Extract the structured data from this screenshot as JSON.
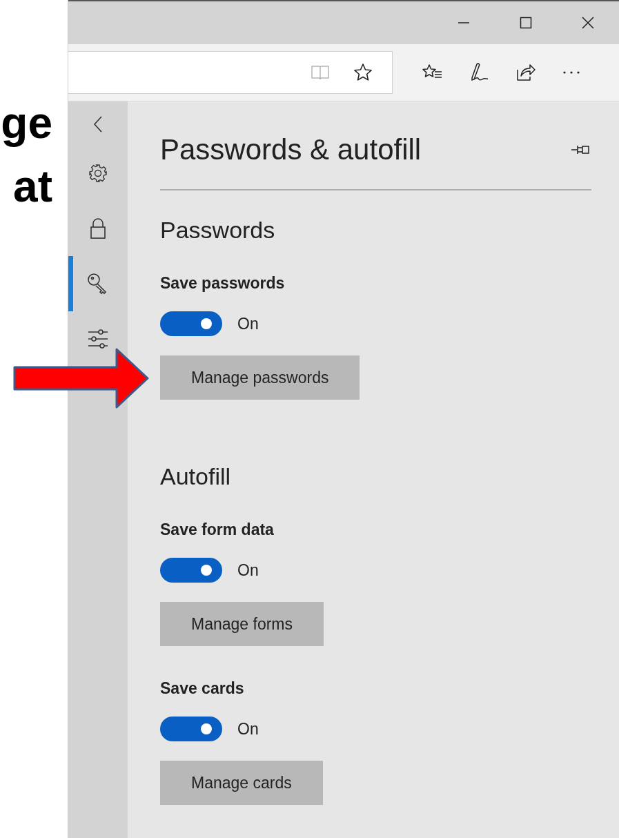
{
  "slide_text": [
    "ge",
    "at"
  ],
  "window": {
    "controls": [
      {
        "kind": "minimize"
      },
      {
        "kind": "maximize"
      },
      {
        "kind": "close"
      }
    ]
  },
  "toolbar": {
    "field_icons": [
      {
        "kind": "reading"
      },
      {
        "kind": "favorite"
      }
    ],
    "actions": [
      {
        "kind": "favorites"
      },
      {
        "kind": "notes"
      },
      {
        "kind": "share"
      },
      {
        "kind": "more"
      }
    ]
  },
  "sidebar": {
    "items": [
      {
        "kind": "back",
        "selected": false
      },
      {
        "kind": "settings",
        "selected": false
      },
      {
        "kind": "privacy",
        "selected": false
      },
      {
        "kind": "passwords",
        "selected": true
      },
      {
        "kind": "advanced",
        "selected": false
      }
    ]
  },
  "panel": {
    "title": "Passwords & autofill",
    "pinned": false,
    "sections": [
      {
        "heading": "Passwords",
        "settings": [
          {
            "label": "Save passwords",
            "on": true,
            "state_text": "On",
            "button": "Manage passwords"
          }
        ]
      },
      {
        "heading": "Autofill",
        "settings": [
          {
            "label": "Save form data",
            "on": true,
            "state_text": "On",
            "button": "Manage forms"
          },
          {
            "label": "Save cards",
            "on": true,
            "state_text": "On",
            "button": "Manage cards"
          }
        ]
      }
    ]
  },
  "callout": {
    "kind": "arrow"
  }
}
